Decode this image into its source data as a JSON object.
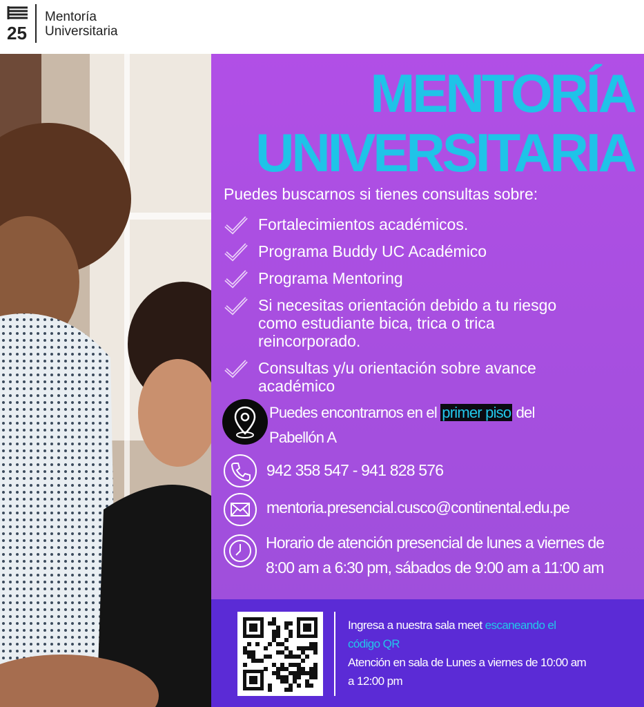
{
  "header": {
    "logo_number": "25",
    "brand_line1": "Mentoría",
    "brand_line2": "Universitaria"
  },
  "poster": {
    "title_line1": "MENTORÍA",
    "title_line2": "UNIVERSITARIA",
    "intro": "Puedes buscarnos si tienes consultas sobre:",
    "topics": [
      "Fortalecimientos académicos.",
      "Programa Buddy UC Académico",
      "Programa Mentoring",
      "Si necesitas orientación debido a tu riesgo como estudiante bica, trica o trica reincorporado.",
      "Consultas y/u orientación sobre avance académico"
    ]
  },
  "contact": {
    "location_pre": "Puedes encontrarnos en el",
    "location_highlight": "primer piso",
    "location_post": "del",
    "location_line2": "Pabellón A",
    "phones": "942 358 547 - 941 828 576",
    "email": "mentoria.presencial.cusco@continental.edu.pe",
    "hours_line1": "Horario de atención presencial de lunes a viernes de",
    "hours_line2": "8:00 am  a 6:30 pm, sábados de 9:00 am a 11:00 am"
  },
  "meet": {
    "line1_pre": "Ingresa a nuestra sala meet",
    "line1_highlight": "escaneando el",
    "line2_highlight": "código QR",
    "line3": "Atención en sala de Lunes a viernes de 10:00 am",
    "line4": "a 12:00 pm"
  },
  "colors": {
    "panel_purple": "#a84fe0",
    "title_cyan": "#1fc3e8",
    "band_indigo": "#5b2bd6"
  },
  "icons": [
    "check-icon",
    "location-pin-icon",
    "phone-icon",
    "mail-icon",
    "clock-icon",
    "qr-code"
  ]
}
